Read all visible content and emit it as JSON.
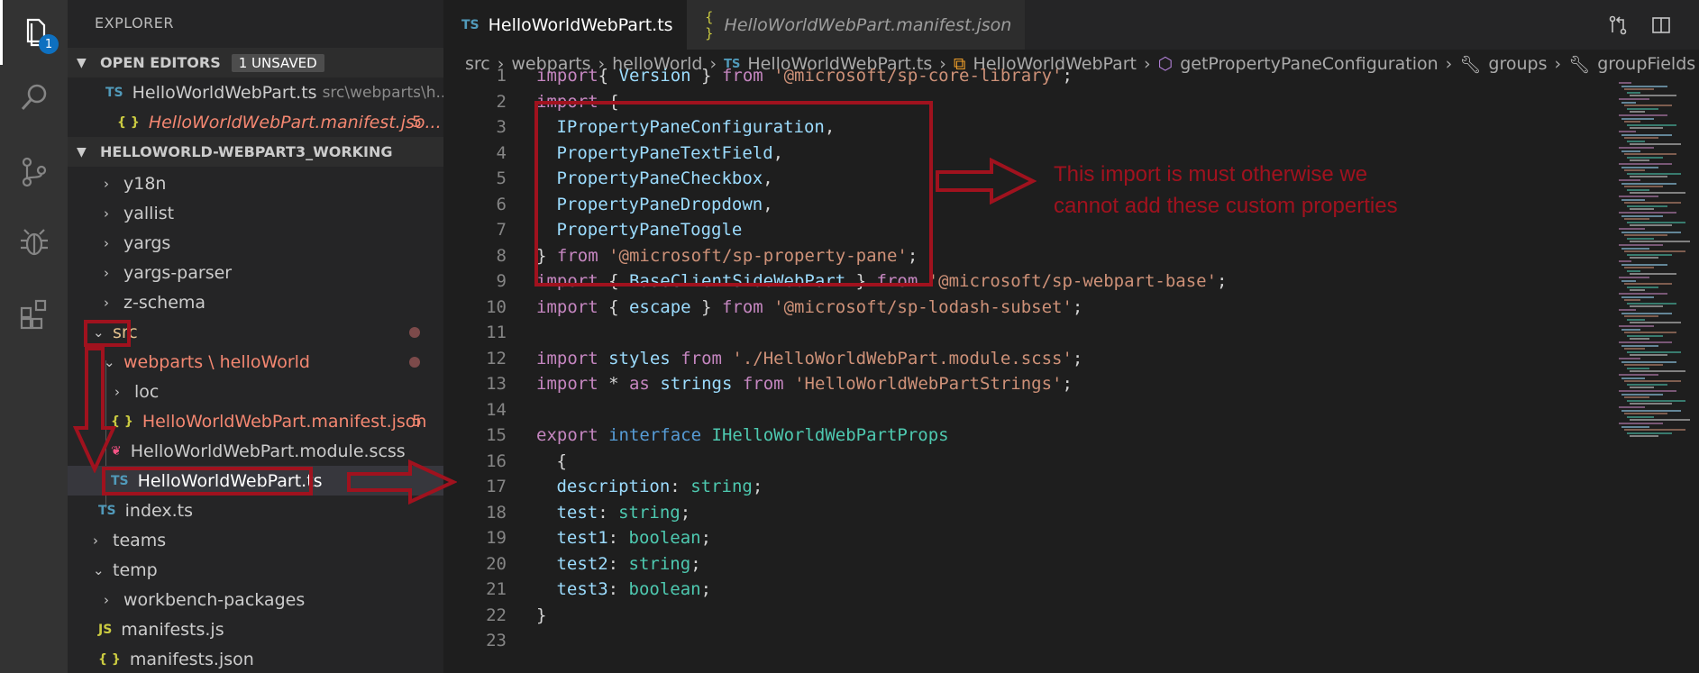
{
  "activity": {
    "explorer_badge": "1"
  },
  "sidebar": {
    "title": "EXPLORER",
    "open_editors": {
      "header": "OPEN EDITORS",
      "badge": "1 UNSAVED",
      "items": [
        {
          "icon": "TS",
          "name": "HelloWorldWebPart.ts",
          "path": "src\\webparts\\h..."
        },
        {
          "icon": "{ }",
          "name": "HelloWorldWebPart.manifest.jso...",
          "count": "5"
        }
      ]
    },
    "folder": {
      "header": "HELLOWORLD-WEBPART3_WORKING",
      "items": [
        {
          "name": "y18n"
        },
        {
          "name": "yallist"
        },
        {
          "name": "yargs"
        },
        {
          "name": "yargs-parser"
        },
        {
          "name": "z-schema"
        },
        {
          "name": "src"
        },
        {
          "name": "webparts \\ helloWorld"
        },
        {
          "name": "loc"
        },
        {
          "icon": "{ }",
          "name": "HelloWorldWebPart.manifest.json",
          "count": "5"
        },
        {
          "name": "HelloWorldWebPart.module.scss"
        },
        {
          "icon": "TS",
          "name": "HelloWorldWebPart.ts"
        },
        {
          "icon": "TS",
          "name": "index.ts"
        },
        {
          "name": "teams"
        },
        {
          "name": "temp"
        },
        {
          "name": "workbench-packages"
        },
        {
          "icon": "JS",
          "name": "manifests.js"
        },
        {
          "icon": "{ }",
          "name": "manifests.json"
        }
      ]
    }
  },
  "tabs": [
    {
      "icon": "TS",
      "label": "HelloWorldWebPart.ts"
    },
    {
      "icon": "{ }",
      "label": "HelloWorldWebPart.manifest.json"
    }
  ],
  "breadcrumbs": [
    "src",
    "webparts",
    "helloWorld",
    "HelloWorldWebPart.ts",
    "HelloWorldWebPart",
    "getPropertyPaneConfiguration",
    "groups",
    "groupFields"
  ],
  "breadcrumb_icons": {
    "file": "TS"
  },
  "editor": {
    "line_numbers": [
      "1",
      "2",
      "3",
      "4",
      "5",
      "6",
      "7",
      "8",
      "9",
      "10",
      "11",
      "12",
      "13",
      "14",
      "15",
      "16",
      "17",
      "18",
      "19",
      "20",
      "21",
      "22",
      "23"
    ],
    "lines": [
      [
        [
          "kw",
          "import"
        ],
        [
          "",
          "{ "
        ],
        [
          "var",
          "Version"
        ],
        [
          "",
          " } "
        ],
        [
          "kw",
          "from"
        ],
        [
          "",
          " "
        ],
        [
          "str",
          "'@microsoft/sp-core-library'"
        ],
        [
          "",
          ";"
        ]
      ],
      [
        [
          "kw",
          "import"
        ],
        [
          "",
          " {"
        ]
      ],
      [
        [
          "",
          " "
        ],
        [
          "var",
          "IPropertyPaneConfiguration"
        ],
        [
          "",
          ","
        ]
      ],
      [
        [
          "",
          " "
        ],
        [
          "var",
          "PropertyPaneTextField"
        ],
        [
          "",
          ","
        ]
      ],
      [
        [
          "",
          " "
        ],
        [
          "var",
          "PropertyPaneCheckbox"
        ],
        [
          "",
          ","
        ]
      ],
      [
        [
          "",
          " "
        ],
        [
          "var",
          "PropertyPaneDropdown"
        ],
        [
          "",
          ","
        ]
      ],
      [
        [
          "",
          " "
        ],
        [
          "var",
          "PropertyPaneToggle"
        ]
      ],
      [
        [
          "",
          "} "
        ],
        [
          "kw",
          "from"
        ],
        [
          "",
          " "
        ],
        [
          "str",
          "'@microsoft/sp-property-pane'"
        ],
        [
          "",
          ";"
        ]
      ],
      [
        [
          "kw",
          "import"
        ],
        [
          "",
          " { "
        ],
        [
          "var",
          "BaseClientSideWebPart"
        ],
        [
          "",
          " } "
        ],
        [
          "kw",
          "from"
        ],
        [
          "",
          " "
        ],
        [
          "str",
          "'@microsoft/sp-webpart-base'"
        ],
        [
          "",
          ";"
        ]
      ],
      [
        [
          "kw",
          "import"
        ],
        [
          "",
          " { "
        ],
        [
          "var",
          "escape"
        ],
        [
          "",
          " } "
        ],
        [
          "kw",
          "from"
        ],
        [
          "",
          " "
        ],
        [
          "str",
          "'@microsoft/sp-lodash-subset'"
        ],
        [
          "",
          ";"
        ]
      ],
      [],
      [
        [
          "kw",
          "import"
        ],
        [
          "",
          " "
        ],
        [
          "var",
          "styles"
        ],
        [
          "",
          " "
        ],
        [
          "kw",
          "from"
        ],
        [
          "",
          " "
        ],
        [
          "str",
          "'./HelloWorldWebPart.module.scss'"
        ],
        [
          "",
          ";"
        ]
      ],
      [
        [
          "kw",
          "import"
        ],
        [
          "",
          " * "
        ],
        [
          "kw",
          "as"
        ],
        [
          "",
          " "
        ],
        [
          "var",
          "strings"
        ],
        [
          "",
          " "
        ],
        [
          "kw",
          "from"
        ],
        [
          "",
          " "
        ],
        [
          "str",
          "'HelloWorldWebPartStrings'"
        ],
        [
          "",
          ";"
        ]
      ],
      [],
      [
        [
          "kw",
          "export"
        ],
        [
          "",
          " "
        ],
        [
          "kw2",
          "interface"
        ],
        [
          "",
          " "
        ],
        [
          "ty",
          "IHelloWorldWebPartProps"
        ]
      ],
      [
        [
          "",
          " {"
        ]
      ],
      [
        [
          "",
          " "
        ],
        [
          "var",
          "description"
        ],
        [
          "",
          ": "
        ],
        [
          "ty",
          "string"
        ],
        [
          "",
          ";"
        ]
      ],
      [
        [
          "",
          " "
        ],
        [
          "var",
          "test"
        ],
        [
          "",
          ": "
        ],
        [
          "ty",
          "string"
        ],
        [
          "",
          ";"
        ]
      ],
      [
        [
          "",
          " "
        ],
        [
          "var",
          "test1"
        ],
        [
          "",
          ": "
        ],
        [
          "ty",
          "boolean"
        ],
        [
          "",
          ";"
        ]
      ],
      [
        [
          "",
          " "
        ],
        [
          "var",
          "test2"
        ],
        [
          "",
          ": "
        ],
        [
          "ty",
          "string"
        ],
        [
          "",
          ";"
        ]
      ],
      [
        [
          "",
          " "
        ],
        [
          "var",
          "test3"
        ],
        [
          "",
          ": "
        ],
        [
          "ty",
          "boolean"
        ],
        [
          "",
          ";"
        ]
      ],
      [
        [
          "",
          "}"
        ]
      ],
      []
    ]
  },
  "annotation": {
    "note": "This import is must otherwise we cannot add these custom properties",
    "color": "#a0121e"
  },
  "colors": {
    "accent": "#0e70c0",
    "annotation": "#a0121e"
  }
}
